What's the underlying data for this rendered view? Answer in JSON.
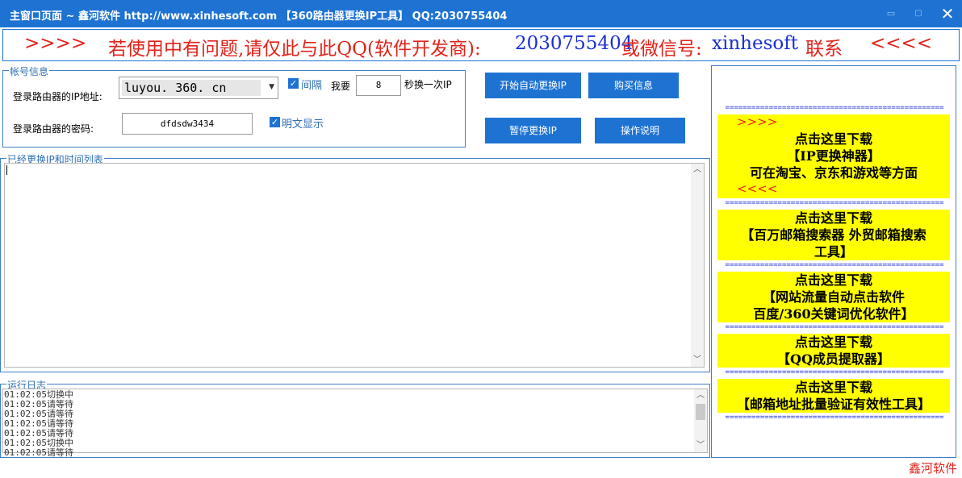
{
  "window": {
    "title": "主窗口页面 ~ 鑫河软件 http://www.xinhesoft.com 【360路由器更换IP工具】 QQ:2030755404",
    "min_glyph": "▭",
    "max_glyph": "▢",
    "close_glyph": "✕"
  },
  "banner": {
    "left_arrows": ">>>>",
    "text_red": "若使用中有问题,请仅此与此QQ(软件开发商):",
    "qq": "2030755404",
    "text_mid": "或微信号:",
    "wechat": "xinhesoft",
    "text_end": "联系",
    "right_arrows": "<<<<"
  },
  "account": {
    "legend": "帐号信息",
    "router_ip_label": "登录路由器的IP地址:",
    "router_ip_value": "luyou. 360. cn",
    "interval_checked": true,
    "interval_label": "间隔",
    "want_label": "我要",
    "seconds_value": "8",
    "seconds_suffix": "秒换一次IP",
    "password_label": "登录路由器的密码:",
    "password_value": "dfdsdw3434",
    "show_plain_checked": true,
    "show_plain_label": "明文显示"
  },
  "buttons": {
    "start": "开始自动更换IP",
    "buy": "购买信息",
    "pause": "暂停更换IP",
    "help": "操作说明"
  },
  "iplist": {
    "legend": "已经更换IP和时间列表"
  },
  "runlog": {
    "legend": "运行日志",
    "lines": [
      "01:02:05切换中",
      "01:02:05请等待",
      "01:02:05请等待",
      "01:02:05请等待",
      "01:02:05请等待",
      "01:02:05切换中",
      "01:02:05请等待"
    ]
  },
  "ads": {
    "separator": "==================================================",
    "arrows_right": ">>>>",
    "arrows_left": "<<<<",
    "items": [
      {
        "lines": [
          "点击这里下载",
          "【IP更换神器】",
          "可在淘宝、京东和游戏等方面"
        ]
      },
      {
        "lines": [
          "点击这里下载",
          "【百万邮箱搜索器 外贸邮箱搜索",
          "工具】"
        ]
      },
      {
        "lines": [
          "点击这里下载",
          "【网站流量自动点击软件",
          "百度/360关键词优化软件】"
        ]
      },
      {
        "lines": [
          "点击这里下载",
          "【QQ成员提取器】"
        ]
      },
      {
        "lines": [
          "点击这里下载",
          "【邮箱地址批量验证有效性工具】"
        ]
      }
    ]
  },
  "footer": {
    "brand": "鑫河软件"
  }
}
